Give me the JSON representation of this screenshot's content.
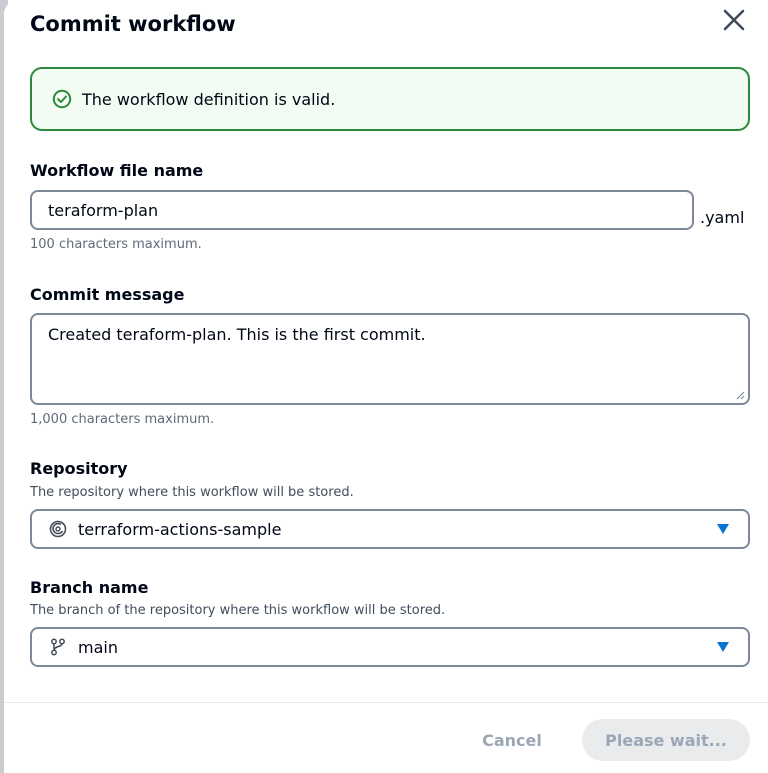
{
  "dialog": {
    "title": "Commit workflow",
    "close_icon": "close-icon"
  },
  "alert": {
    "icon": "check-circle-icon",
    "text": "The workflow definition is valid.",
    "color": "#2a8a3a"
  },
  "workflow_file": {
    "label": "Workflow file name",
    "value": "teraform-plan",
    "suffix": ".yaml",
    "constraint": "100 characters maximum."
  },
  "commit_message": {
    "label": "Commit message",
    "value": "Created teraform-plan. This is the first commit.",
    "constraint": "1,000 characters maximum."
  },
  "repository": {
    "label": "Repository",
    "description": "The repository where this workflow will be stored.",
    "value": "terraform-actions-sample",
    "icon": "repository-icon"
  },
  "branch": {
    "label": "Branch name",
    "description": "The branch of the repository where this workflow will be stored.",
    "value": "main",
    "icon": "branch-icon"
  },
  "footer": {
    "cancel_label": "Cancel",
    "submit_label": "Please wait..."
  },
  "colors": {
    "accent": "#0972d3",
    "success": "#2a8a3a",
    "disabled_text": "#9ba7b6",
    "disabled_bg": "#e9ebed"
  }
}
